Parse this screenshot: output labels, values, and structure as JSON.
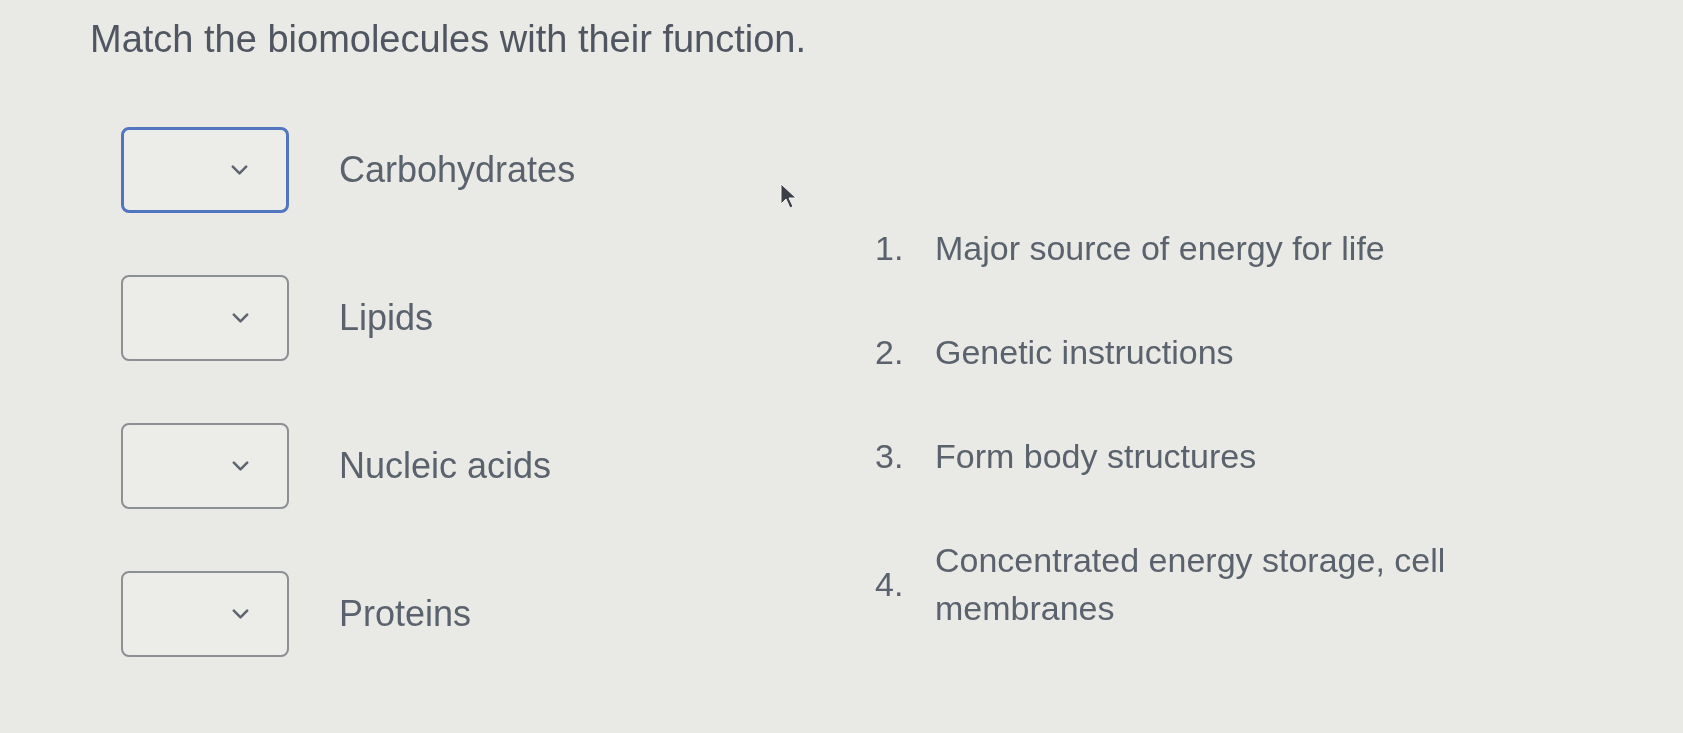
{
  "title": "Match the biomolecules with their function.",
  "matches": [
    {
      "label": "Carbohydrates",
      "focused": true
    },
    {
      "label": "Lipids",
      "focused": false
    },
    {
      "label": "Nucleic acids",
      "focused": false
    },
    {
      "label": "Proteins",
      "focused": false
    }
  ],
  "functions": [
    {
      "number": "1.",
      "text": "Major source of energy for life"
    },
    {
      "number": "2.",
      "text": "Genetic instructions"
    },
    {
      "number": "3.",
      "text": "Form body structures"
    },
    {
      "number": "4.",
      "text": "Concentrated energy storage, cell membranes"
    }
  ]
}
